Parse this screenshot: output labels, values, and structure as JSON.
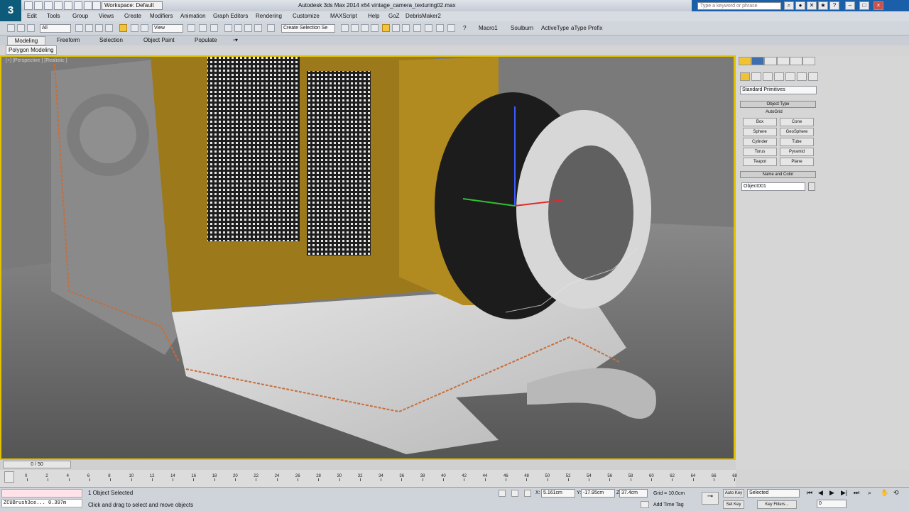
{
  "titlebar": {
    "workspace": "Workspace: Default",
    "title": "Autodesk 3ds Max 2014 x64      vintage_camera_texturing02.max",
    "search_placeholder": "Type a keyword or phrase"
  },
  "menu": [
    "Edit",
    "Tools",
    "Group",
    "Views",
    "Create",
    "Modifiers",
    "Animation",
    "Graph Editors",
    "Rendering",
    "Customize",
    "MAXScript",
    "Help",
    "GoZ",
    "DebrisMaker2"
  ],
  "toolbar": {
    "filter": "All",
    "ref_coord": "View",
    "sel_set": "Create Selection Se",
    "macro1": "Macro1",
    "soulburn": "Soulburn",
    "activetype": "ActiveType",
    "prefix": "aType Prefix"
  },
  "ribbon": {
    "tabs": [
      "Modeling",
      "Freeform",
      "Selection",
      "Object Paint",
      "Populate"
    ],
    "panel": "Polygon Modeling"
  },
  "viewport": {
    "label": "[+] [Perspective ] [Realistic ]"
  },
  "command_panel": {
    "dropdown": "Standard Primitives",
    "object_type_title": "Object Type",
    "autogrid": "AutoGrid",
    "buttons": [
      "Box",
      "Cone",
      "Sphere",
      "GeoSphere",
      "Cylinder",
      "Tube",
      "Torus",
      "Pyramid",
      "Teapot",
      "Plane"
    ],
    "name_color_title": "Name and Color",
    "name_value": "Object001"
  },
  "timeline": {
    "frame": "0 / 50",
    "ticks": [
      "0",
      "2",
      "4",
      "6",
      "8",
      "10",
      "12",
      "14",
      "16",
      "18",
      "20",
      "22",
      "24",
      "26",
      "28",
      "30",
      "32",
      "34",
      "36",
      "38",
      "40",
      "42",
      "44",
      "46",
      "48",
      "50",
      "52",
      "54",
      "56",
      "58",
      "60",
      "62",
      "64",
      "66",
      "68"
    ]
  },
  "status": {
    "maxscript": "ZCUBrush3ce... 0.397m",
    "selected": "1 Object Selected",
    "prompt": "Click and drag to select and move objects",
    "x_label": "X:",
    "x": "5.161cm",
    "y_label": "Y:",
    "y": "-17.95cm",
    "z_label": "Z:",
    "z": "37.4cm",
    "grid": "Grid = 10.0cm",
    "add_time_tag": "Add Time Tag",
    "auto_key": "Auto Key",
    "selected_dd": "Selected",
    "set_key": "Set Key",
    "key_filters": "Key Filters...",
    "frame_field": "0"
  }
}
